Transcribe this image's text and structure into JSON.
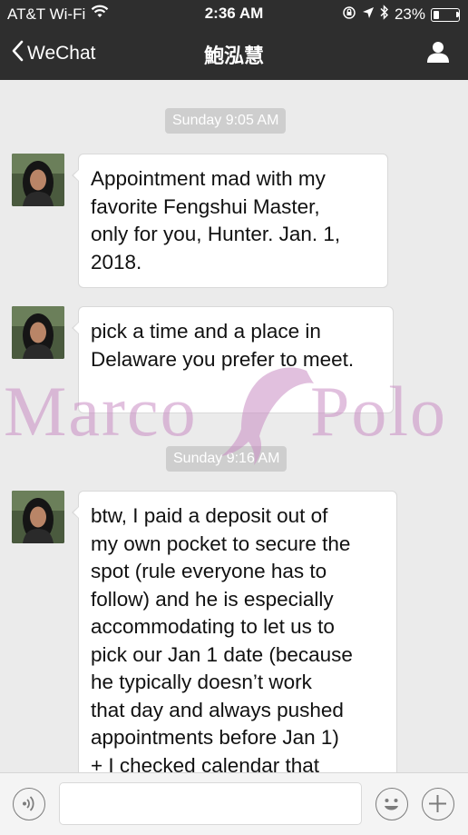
{
  "status_bar": {
    "carrier": "AT&T Wi-Fi",
    "time": "2:36 AM",
    "battery_percent": "23%",
    "battery_level": 0.23,
    "icons": [
      "wifi-icon",
      "orientation-lock-icon",
      "location-icon",
      "bluetooth-icon",
      "battery-icon"
    ]
  },
  "nav": {
    "back_label": "WeChat",
    "title": "鮑泓慧",
    "profile_icon": "person-icon"
  },
  "chat": {
    "timestamps": [
      "Sunday 9:05 AM",
      "Sunday 9:16 AM"
    ],
    "messages": [
      {
        "sender": "contact",
        "lines": [
          "Appointment mad with my",
          "favorite Fengshui Master,",
          "only for you, Hunter.  Jan. 1,",
          "2018."
        ]
      },
      {
        "sender": "contact",
        "lines": [
          "pick a time and a place in",
          "Delaware you prefer to meet."
        ]
      },
      {
        "sender": "contact",
        "lines": [
          "btw, I paid a deposit out of",
          "my own pocket to secure the",
          "spot (rule everyone has to",
          "follow) and he is especially",
          "accommodating to let us to",
          "pick our Jan 1 date (because",
          "he  typically doesn’t work",
          "that day and always pushed",
          "appointments before Jan 1)",
          "+ I checked calendar that"
        ]
      }
    ]
  },
  "watermark": {
    "left_text": "Marco",
    "right_text": "Polo",
    "icon": "dolphin-icon",
    "color": "#c88cc3"
  },
  "input_bar": {
    "voice_icon": "voice-icon",
    "emoji_icon": "emoji-icon",
    "add_icon": "plus-icon",
    "text_value": ""
  },
  "colors": {
    "header_bg": "#2e2e2e",
    "chat_bg": "#ebebeb",
    "bubble_bg": "#ffffff",
    "timestamp_bg": "#cecece"
  }
}
